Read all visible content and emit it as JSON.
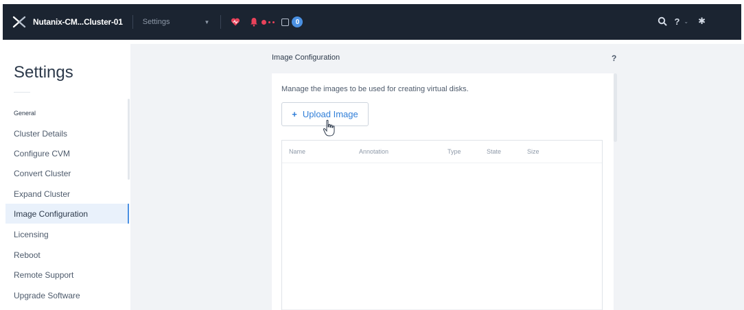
{
  "topbar": {
    "cluster_name": "Nutanix-CM...Cluster-01",
    "menu_label": "Settings",
    "task_count": "0"
  },
  "sidebar": {
    "title": "Settings",
    "section_label": "General",
    "items": [
      {
        "label": "Cluster Details"
      },
      {
        "label": "Configure CVM"
      },
      {
        "label": "Convert Cluster"
      },
      {
        "label": "Expand Cluster"
      },
      {
        "label": "Image Configuration",
        "active": true
      },
      {
        "label": "Licensing"
      },
      {
        "label": "Reboot"
      },
      {
        "label": "Remote Support"
      },
      {
        "label": "Upgrade Software"
      }
    ]
  },
  "main": {
    "header": "Image Configuration",
    "help": "?",
    "description": "Manage the images to be used for creating virtual disks.",
    "upload_button": {
      "icon": "+",
      "label": "Upload Image"
    },
    "table": {
      "columns": [
        "Name",
        "Annotation",
        "Type",
        "State",
        "Size"
      ],
      "rows": []
    }
  },
  "colors": {
    "topbar_bg": "#1b2431",
    "accent": "#2f7ed8",
    "alert": "#e8425a",
    "active_item_bg": "#e9f1fb"
  }
}
